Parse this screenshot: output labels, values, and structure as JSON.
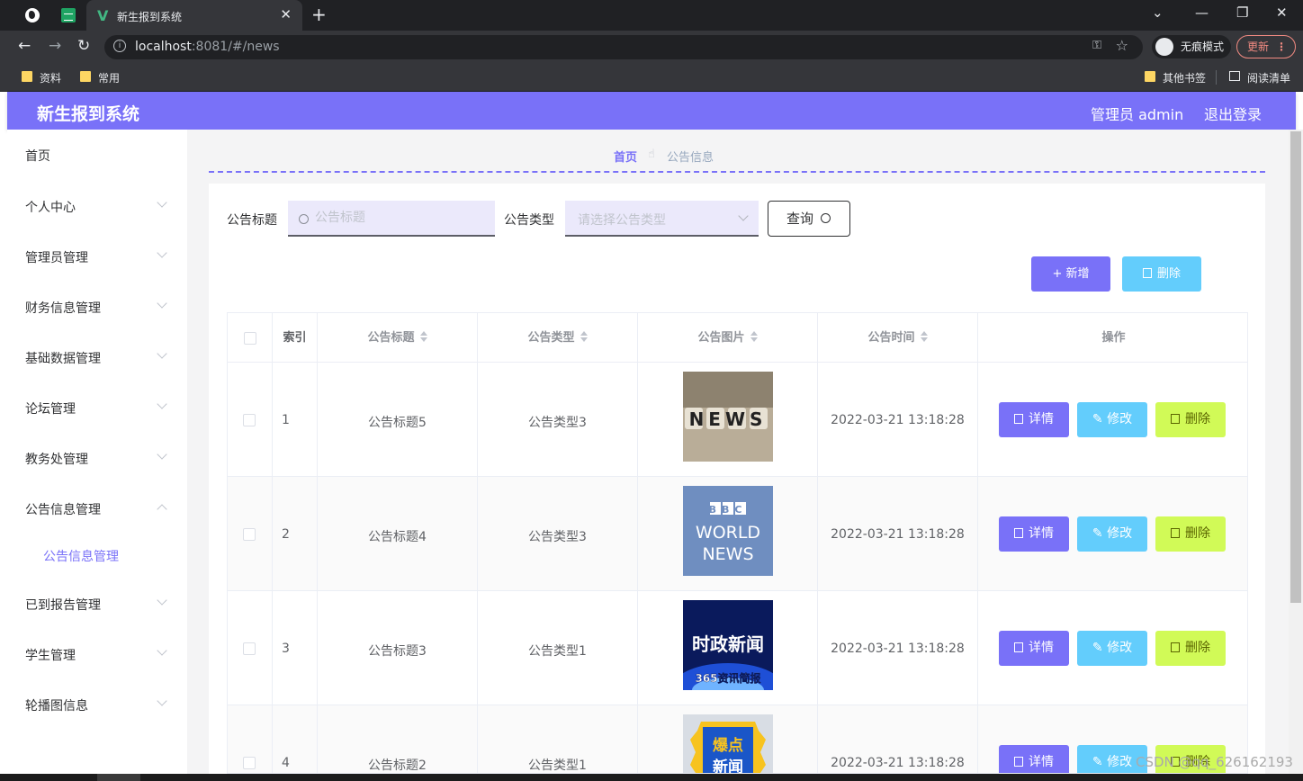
{
  "browser": {
    "tab_title": "新生报到系统",
    "url_host": "localhost",
    "url_path": ":8081/#/news",
    "incognito_label": "无痕模式",
    "update_label": "更新",
    "bookmarks": [
      "资料",
      "常用"
    ],
    "other_bookmarks": "其他书签",
    "reading_list": "阅读清单"
  },
  "header": {
    "title": "新生报到系统",
    "user": "管理员 admin",
    "logout": "退出登录"
  },
  "sidebar": {
    "items": [
      {
        "label": "首页"
      },
      {
        "label": "个人中心"
      },
      {
        "label": "管理员管理"
      },
      {
        "label": "财务信息管理"
      },
      {
        "label": "基础数据管理"
      },
      {
        "label": "论坛管理"
      },
      {
        "label": "教务处管理"
      },
      {
        "label": "公告信息管理"
      },
      {
        "label": "已到报告管理"
      },
      {
        "label": "学生管理"
      },
      {
        "label": "轮播图信息"
      }
    ],
    "sub_item": "公告信息管理"
  },
  "breadcrumb": {
    "home": "首页",
    "current": "公告信息"
  },
  "search": {
    "title_label": "公告标题",
    "title_placeholder": "公告标题",
    "type_label": "公告类型",
    "type_placeholder": "请选择公告类型",
    "query_button": "查询"
  },
  "actions": {
    "add": "新增",
    "delete": "删除"
  },
  "table": {
    "columns": [
      "索引",
      "公告标题",
      "公告类型",
      "公告图片",
      "公告时间",
      "操作"
    ],
    "rows": [
      {
        "index": "1",
        "title": "公告标题5",
        "type": "公告类型3",
        "image": "NEWS",
        "time": "2022-03-21 13:18:28"
      },
      {
        "index": "2",
        "title": "公告标题4",
        "type": "公告类型3",
        "image": "BBC WORLD NEWS",
        "time": "2022-03-21 13:18:28"
      },
      {
        "index": "3",
        "title": "公告标题3",
        "type": "公告类型1",
        "image": "时政新闻 365资讯简报",
        "time": "2022-03-21 13:18:28"
      },
      {
        "index": "4",
        "title": "公告标题2",
        "type": "公告类型1",
        "image": "爆点新闻",
        "time": "2022-03-21 13:18:28"
      }
    ],
    "row_actions": {
      "detail": "详情",
      "edit": "修改",
      "delete": "删除"
    }
  },
  "images": {
    "news": "NEWS",
    "bbc_logo": "BBC",
    "bbc_world": "WORLD",
    "bbc_news": "NEWS",
    "shizheng_main": "时政新闻",
    "shizheng_sub": "365资讯简报",
    "baodian_top": "爆点",
    "baodian_bottom": "新闻"
  },
  "watermark": "CSDN @qq_626162193",
  "colors": {
    "primary": "#7971f8",
    "info": "#63cdfc",
    "lime": "#d1fa57"
  }
}
